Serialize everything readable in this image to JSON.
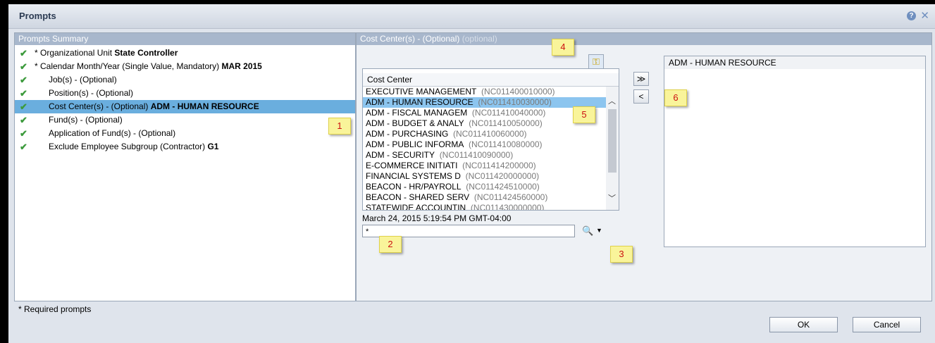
{
  "dialog": {
    "title": "Prompts"
  },
  "summary": {
    "header": "Prompts Summary",
    "items": [
      {
        "prefix": "* Organizational Unit ",
        "value": "State Controller"
      },
      {
        "prefix": "* Calendar Month/Year (Single Value, Mandatory) ",
        "value": "MAR 2015"
      },
      {
        "prefix": "Job(s) - (Optional)",
        "value": ""
      },
      {
        "prefix": "Position(s) - (Optional)",
        "value": ""
      },
      {
        "prefix": "Cost Center(s) - (Optional) ",
        "value": "ADM - HUMAN RESOURCE"
      },
      {
        "prefix": "Fund(s) - (Optional)",
        "value": ""
      },
      {
        "prefix": "Application of Fund(s) - (Optional)",
        "value": ""
      },
      {
        "prefix": "Exclude Employee Subgroup (Contractor) ",
        "value": "G1"
      }
    ]
  },
  "detail": {
    "header": "Cost Center(s) - (Optional)",
    "header_hint": "(optional)",
    "list_header": "Cost Center",
    "rows": [
      {
        "name": "EXECUTIVE MANAGEMENT",
        "code": "(NC011400010000)"
      },
      {
        "name": "ADM - HUMAN RESOURCE",
        "code": "(NC011410030000)"
      },
      {
        "name": "ADM - FISCAL MANAGEM",
        "code": "(NC011410040000)"
      },
      {
        "name": "ADM - BUDGET & ANALY",
        "code": "(NC011410050000)"
      },
      {
        "name": "ADM - PURCHASING",
        "code": "(NC011410060000)"
      },
      {
        "name": "ADM - PUBLIC INFORMA",
        "code": "(NC011410080000)"
      },
      {
        "name": "ADM - SECURITY",
        "code": "(NC011410090000)"
      },
      {
        "name": "E-COMMERCE INITIATI",
        "code": "(NC011414200000)"
      },
      {
        "name": "FINANCIAL SYSTEMS D",
        "code": "(NC011420000000)"
      },
      {
        "name": "BEACON - HR/PAYROLL",
        "code": "(NC011424510000)"
      },
      {
        "name": "BEACON - SHARED SERV",
        "code": "(NC011424560000)"
      },
      {
        "name": "STATEWIDE ACCOUNTIN",
        "code": "(NC011430000000)"
      }
    ],
    "refresh_time": "March 24, 2015 5:19:54 PM GMT-04:00",
    "search_value": "*",
    "add_label": "≫",
    "remove_label": "<",
    "selected": [
      "ADM - HUMAN RESOURCE"
    ]
  },
  "callouts": [
    "1",
    "2",
    "3",
    "4",
    "5",
    "6"
  ],
  "footer": {
    "note": "* Required prompts",
    "ok": "OK",
    "cancel": "Cancel"
  },
  "icons": [
    "help-icon",
    "close-icon",
    "check-icon",
    "key-icon",
    "search-icon",
    "dropdown-icon"
  ]
}
